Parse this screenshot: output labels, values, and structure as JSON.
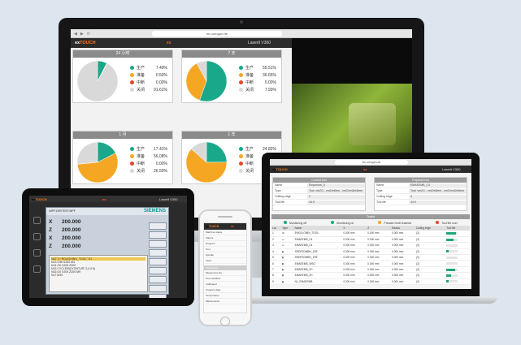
{
  "imac": {
    "url": "tec.wengen.de",
    "brand_prefix": "ex",
    "brand_main": "TOUCH",
    "brand_red": "ex",
    "machine": "Laserlt V300",
    "panels": [
      {
        "title": "24 小时",
        "slices": [
          {
            "label": "生产",
            "value": "7.49%",
            "pct": 7.49
          },
          {
            "label": "准备",
            "value": "0.50%",
            "pct": 0.5
          },
          {
            "label": "中断",
            "value": "0.00%",
            "pct": 0.0
          },
          {
            "label": "关闭",
            "value": "91.61%",
            "pct": 91.61
          }
        ]
      },
      {
        "title": "7 天",
        "slices": [
          {
            "label": "生产",
            "value": "55.51%",
            "pct": 55.51
          },
          {
            "label": "准备",
            "value": "36.65%",
            "pct": 36.65
          },
          {
            "label": "中断",
            "value": "0.00%",
            "pct": 0.0
          },
          {
            "label": "关闭",
            "value": "7.93%",
            "pct": 7.93
          }
        ]
      },
      {
        "title": "1 月",
        "slices": [
          {
            "label": "生产",
            "value": "17.41%",
            "pct": 17.41
          },
          {
            "label": "准备",
            "value": "56.08%",
            "pct": 56.08
          },
          {
            "label": "中断",
            "value": "0.00%",
            "pct": 0.0
          },
          {
            "label": "关闭",
            "value": "26.50%",
            "pct": 26.5
          }
        ]
      },
      {
        "title": "1 年",
        "slices": [
          {
            "label": "生产",
            "value": "24.82%",
            "pct": 24.82
          },
          {
            "label": "准备",
            "value": "61.77%",
            "pct": 61.77
          },
          {
            "label": "中断",
            "value": "0.00%",
            "pct": 0.0
          },
          {
            "label": "关闭",
            "value": "13.41%",
            "pct": 13.41
          }
        ]
      }
    ],
    "camera_url": "tec.wengen.de",
    "colors": {
      "production": "#1aa88a",
      "preparation": "#f5a623",
      "interruption": "#e8452c",
      "off": "#d9d9d9",
      "brand_accent": "#ff7a1a"
    }
  },
  "laptop": {
    "url": "tec.wengen.de",
    "brand_prefix": "ex",
    "brand_main": "TOUCH",
    "brand_red": "ex",
    "machine": "Laserlt V300",
    "current_tool": {
      "title": "Current tool",
      "rows": [
        {
          "key": "Name",
          "value": "Emporium_0"
        },
        {
          "key": "Type",
          "value": "Tool: vm2/1 - vm2/e4lem - vm2/vm2/e4lem"
        },
        {
          "key": "Cutting edge",
          "value": "2"
        },
        {
          "key": "Tool life",
          "value": "44.9"
        }
      ]
    },
    "prepared_tool": {
      "title": "Prepared tool",
      "rows": [
        {
          "key": "Name",
          "value": "EMAEEMB_C4"
        },
        {
          "key": "Type",
          "value": "Tool: vm2/1 - vm2/e4lem - vm2/vm2/e4lem"
        },
        {
          "key": "Cutting edge",
          "value": "4"
        },
        {
          "key": "Tool life",
          "value": "44.9"
        }
      ]
    },
    "tools_title": "Toolist",
    "legend": [
      {
        "label": "Monitoring off",
        "color": "#1aa88a"
      },
      {
        "label": "Monitoring on",
        "color": "#1aa88a"
      },
      {
        "label": "Prewarn limit reached",
        "color": "#f5a623"
      },
      {
        "label": "Tool life over",
        "color": "#e8452c"
      }
    ],
    "columns": [
      "Loc",
      "Type",
      "Name",
      "X",
      "Z",
      "Radius",
      "Cutting edge",
      "Tool life"
    ],
    "rows": [
      [
        "1",
        "⚙",
        "EKKOLOMIN_TOOL",
        "0.000 mm",
        "0.000 mm",
        "0.000 mm",
        "(3)",
        ""
      ],
      [
        "2",
        "⊔",
        "EMAEEMB_C4",
        "0.000 mm",
        "0.000 mm",
        "0.000 mm",
        "(3)",
        ""
      ],
      [
        "3",
        "⊔",
        "EMAEEMB_C4",
        "0.000 mm",
        "0.000 mm",
        "0.000 mm",
        "(3)",
        ""
      ],
      [
        "4",
        "▮",
        "SRDFEDMBH_1RE",
        "0.000 mm",
        "0.000 mm",
        "0.000 mm",
        "(3)",
        ""
      ],
      [
        "5",
        "▮",
        "SRDFEDMBH_1RE",
        "0.000 mm",
        "0.000 mm",
        "0.000 mm",
        "(3)",
        ""
      ],
      [
        "6",
        "▮",
        "EMAEEMB_WSO",
        "0.000 mm",
        "0.000 mm",
        "0.000 mm",
        "(3)",
        ""
      ],
      [
        "7",
        "▮",
        "EMAEEMB_2H",
        "0.000 mm",
        "0.000 mm",
        "0.000 mm",
        "(3)",
        ""
      ],
      [
        "8",
        "▮",
        "EMAEEMB_2H",
        "0.000 mm",
        "0.000 mm",
        "0.000 mm",
        "(3)",
        ""
      ],
      [
        "9",
        "▮",
        "NL_EMAEEMB",
        "0.000 mm",
        "0.000 mm",
        "0.000 mm",
        "(3)",
        ""
      ]
    ],
    "tool_life": [
      0.85,
      0.6,
      0.0,
      0.2,
      0.0,
      0.0,
      0.75,
      0.4,
      0.15
    ]
  },
  "tablet": {
    "brand_prefix": "ex",
    "brand_main": "TOUCH",
    "brand_red": "ex",
    "machine": "Laserlt V300",
    "siemens_logo": "SIEMENS",
    "path": "/MPF.DIR/TEST.MPF",
    "axes": [
      {
        "name": "X",
        "value": "200.000"
      },
      {
        "name": "Z",
        "value": "200.000"
      },
      {
        "name": "X",
        "value": "200.000"
      },
      {
        "name": "Z",
        "value": "200.000"
      }
    ],
    "softkeys": [
      "",
      "",
      "",
      "",
      "",
      "",
      "",
      "",
      ""
    ],
    "program_lines": [
      "N12 T=\"ROUGHING_TOOL\" D1",
      "N13 G96 S200 M4",
      "N14 G0 X200 Z200",
      "N15 CYCLE95(\"KONTUR\",2,0,0.5)",
      "N16 G0 X200 Z200 M9",
      "N17 M30"
    ]
  },
  "phone": {
    "brand_prefix": "ex",
    "brand_main": "TOUCH",
    "brand_red": "ex",
    "rows": [
      "Machine status",
      "Alarms",
      "Program",
      "Tool",
      "Spindle",
      "Feed"
    ],
    "section": "Inspections",
    "rows2": [
      "Measurements",
      "Tool condition",
      "Calibrated",
      "Program data",
      "Temperature",
      "Maintenance"
    ]
  }
}
